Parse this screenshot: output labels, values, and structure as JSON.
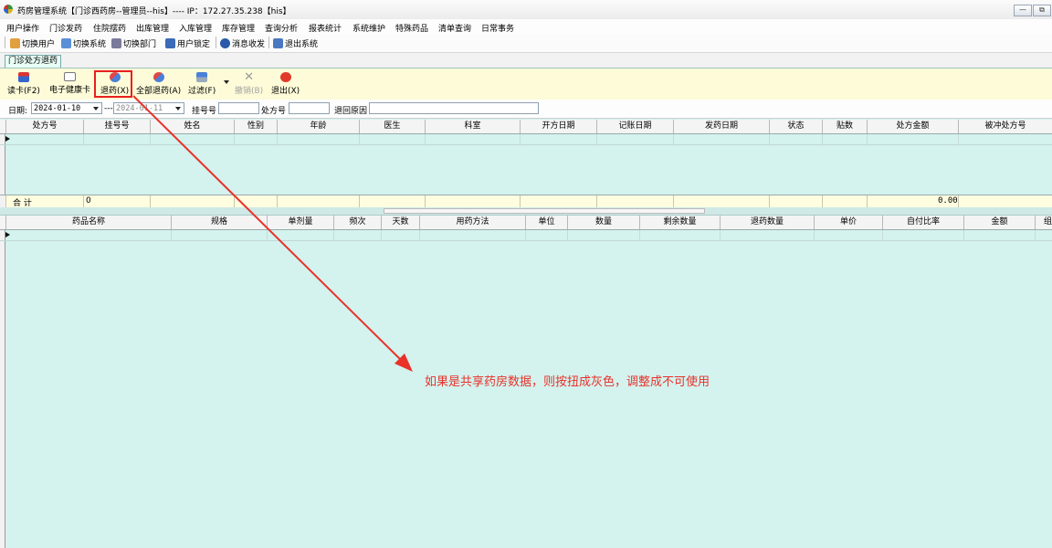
{
  "window": {
    "title": "药房管理系统【门诊西药房--管理员--his】---- IP：172.27.35.238【his】",
    "minimize": "—",
    "restore": "⧉"
  },
  "menu": [
    "用户操作",
    "门诊发药",
    "住院摆药",
    "出库管理",
    "入库管理",
    "库存管理",
    "查询分析",
    "报表统计",
    "系统维护",
    "特殊药品",
    "清单查询",
    "日常事务"
  ],
  "toolbar": {
    "switch_user": "切换用户",
    "switch_system": "切换系统",
    "switch_dept": "切换部门",
    "lock_user": "用户锁定",
    "messages": "消息收发",
    "exit_system": "退出系统"
  },
  "tab": {
    "label": "门诊处方退药"
  },
  "actions": {
    "read_card": "读卡(F2)",
    "ehealth_card": "电子健康卡",
    "return_drug": "退药(X)",
    "return_all": "全部退药(A)",
    "filter": "过滤(F)",
    "revoke": "撤销(B)",
    "exit": "退出(X)"
  },
  "filters": {
    "date_label": "日期:",
    "date_from": "2024-01-10",
    "date_sep": "---",
    "date_to": "2024-01-11",
    "reg_no_label": "挂号号",
    "reg_no_value": "",
    "presc_no_label": "处方号",
    "presc_no_value": "",
    "reject_reason_label": "退回原因",
    "reject_reason_value": ""
  },
  "prescription_grid": {
    "columns": [
      "处方号",
      "挂号号",
      "姓名",
      "性别",
      "年龄",
      "医生",
      "科室",
      "开方日期",
      "记账日期",
      "发药日期",
      "状态",
      "贴数",
      "处方金额",
      "被冲处方号"
    ]
  },
  "summary": {
    "label": "合  计",
    "count": "0",
    "amount": "0.00"
  },
  "drug_grid": {
    "columns": [
      "药品名称",
      "规格",
      "单剂量",
      "频次",
      "天数",
      "用药方法",
      "单位",
      "数量",
      "剩余数量",
      "退药数量",
      "单价",
      "自付比率",
      "金额",
      "组"
    ]
  },
  "annotation": {
    "text": "如果是共享药房数据，则按扭成灰色，调整成不可使用",
    "color": "#e8322a"
  }
}
